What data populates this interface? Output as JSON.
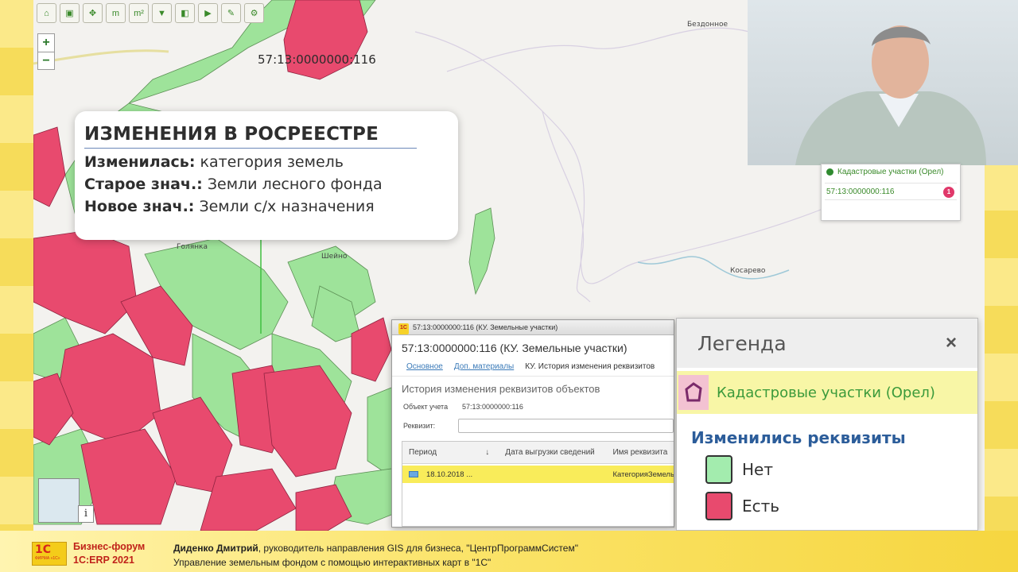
{
  "map": {
    "toolbar_icons": [
      "home-icon",
      "select-icon",
      "pan-icon",
      "measure-m-icon",
      "measure-m2-icon",
      "filter-icon",
      "layer-icon",
      "export-icon",
      "tool-icon",
      "settings-icon"
    ],
    "zoom_in": "+",
    "zoom_out": "−",
    "parcel_label": "57:13:0000000:116",
    "place_labels": [
      "Бездонное",
      "Голянка",
      "Шейно",
      "Косарево"
    ],
    "info_button": "i",
    "colors": {
      "forest": "#9ee39a",
      "changed": "#e84a6e",
      "background": "#f3f2ef"
    }
  },
  "callout": {
    "title": "ИЗМЕНЕНИЯ В РОСРЕЕСТРЕ",
    "rows": [
      {
        "label": "Изменилась:",
        "value": "категория земель"
      },
      {
        "label": "Старое знач.:",
        "value": "Земли лесного фонда"
      },
      {
        "label": "Новое знач.:",
        "value": "Земли с/х назначения"
      }
    ]
  },
  "search_popup": {
    "header": "Кадастровые участки (Орел)",
    "result": "57:13:0000000:116",
    "count": "1"
  },
  "window": {
    "titlebar": "57:13:0000000:116 (КУ. Земельные участки)",
    "title": "57:13:0000000:116 (КУ. Земельные участки)",
    "tabs": [
      "Основное",
      "Доп. материалы",
      "КУ. История изменения реквизитов"
    ],
    "subtitle": "История изменения реквизитов объектов",
    "object_label": "Объект учета",
    "object_value": "57:13:0000000:116",
    "attr_label": "Реквизит:",
    "columns": [
      "Период",
      "Дата выгрузки сведений",
      "Имя реквизита"
    ],
    "sort_arrow": "↓",
    "rows": [
      {
        "period": "18.10.2018 ...",
        "date": "",
        "name": "КатегорияЗемель"
      }
    ]
  },
  "legend": {
    "title": "Легенда",
    "close": "×",
    "layer": "Кадастровые участки (Орел)",
    "group": "Изменились реквизиты",
    "items": [
      {
        "label": "Нет",
        "color": "#a3ecae"
      },
      {
        "label": "Есть",
        "color": "#e84a6e"
      }
    ]
  },
  "banner": {
    "logo_text": "1С",
    "logo_sub": "ФИРМА «1С»",
    "forum_line1": "Бизнес-форум",
    "forum_line2": "1С:ERP 2021",
    "speaker_name": "Диденко Дмитрий",
    "speaker_role": ", руководитель направления GIS для бизнеса, \"ЦентрПрограммСистем\"",
    "topic": "Управление земельным фондом с помощью интерактивных карт в \"1С\""
  }
}
